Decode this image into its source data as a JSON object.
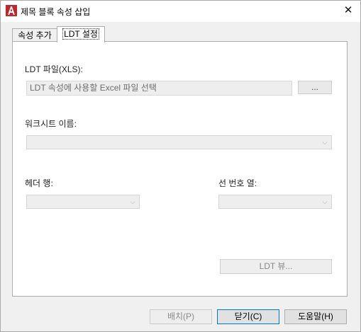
{
  "window": {
    "title": "제목 블록 속성 삽입",
    "close_glyph": "✕"
  },
  "tabs": [
    {
      "label": "속성 추가",
      "selected": false
    },
    {
      "label": "LDT 설정",
      "selected": true
    }
  ],
  "ldt_file": {
    "label": "LDT 파일(XLS):",
    "placeholder": "LDT 속성에 사용할 Excel 파일 선택",
    "browse_label": "..."
  },
  "worksheet": {
    "label": "워크시트 이름:",
    "value": ""
  },
  "header_row": {
    "label": "헤더 행:",
    "value": ""
  },
  "line_number_col": {
    "label": "선 번호 열:",
    "value": ""
  },
  "ldt_view_label": "LDT 뷰...",
  "footer": {
    "place_label": "배치(P)",
    "close_label": "닫기(C)",
    "help_label": "도움말(H)"
  },
  "colors": {
    "accent": "#c0272d",
    "focus": "#0078d7"
  },
  "icons": {
    "app": "autocad-a-icon",
    "close": "close-icon",
    "dropdown": "chevron-down-icon"
  }
}
